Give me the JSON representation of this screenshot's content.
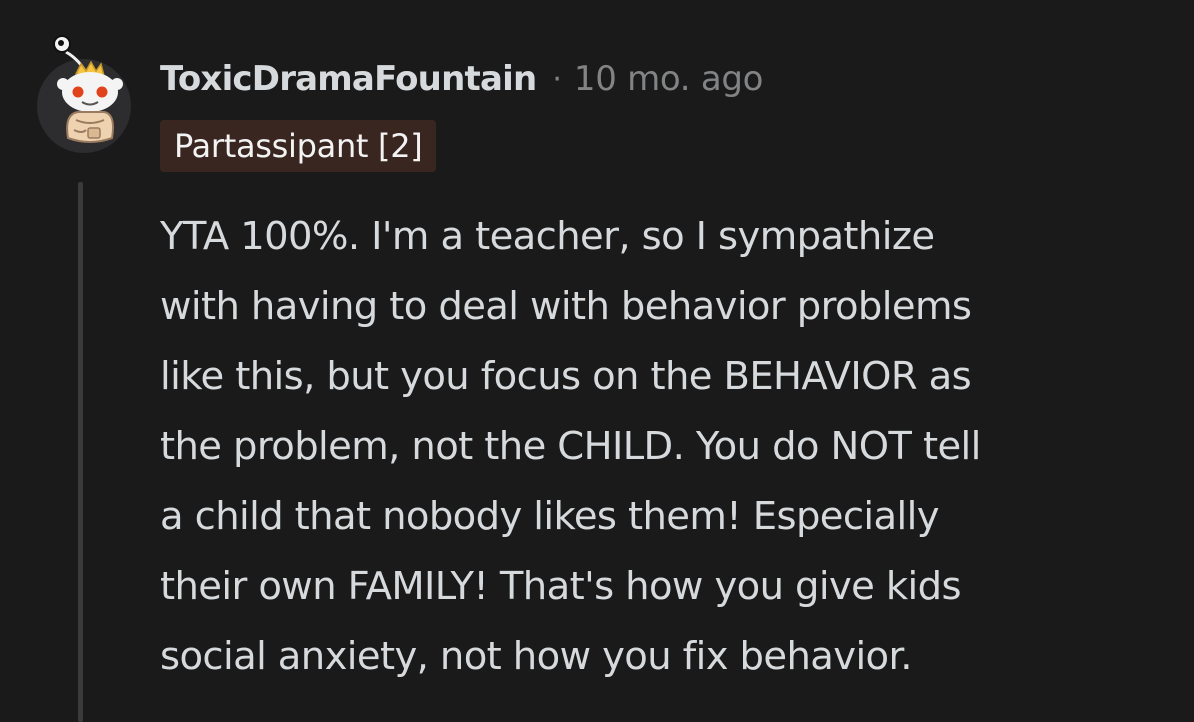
{
  "comment": {
    "author": "ToxicDramaFountain",
    "separator": "·",
    "timestamp": "10 mo. ago",
    "flair": "Partassipant [2]",
    "body_lines": [
      "YTA 100%. I'm a teacher, so I sympathize",
      "with having to deal with behavior problems",
      "like this, but you focus on the BEHAVIOR as",
      "the problem, not the CHILD. You do NOT tell",
      "a child that nobody likes them! Especially",
      "their own FAMILY! That's how you give kids",
      "social anxiety, not how you fix behavior."
    ],
    "avatar_icon": "snoo-avatar-icon"
  },
  "colors": {
    "background": "#1a1a1b",
    "username": "#d7dadc",
    "timestamp": "#818384",
    "body_text": "#d7dadc",
    "flair_bg": "#3a2620",
    "flair_text": "#f3f3f3",
    "thread_line": "#3a3a3c"
  }
}
